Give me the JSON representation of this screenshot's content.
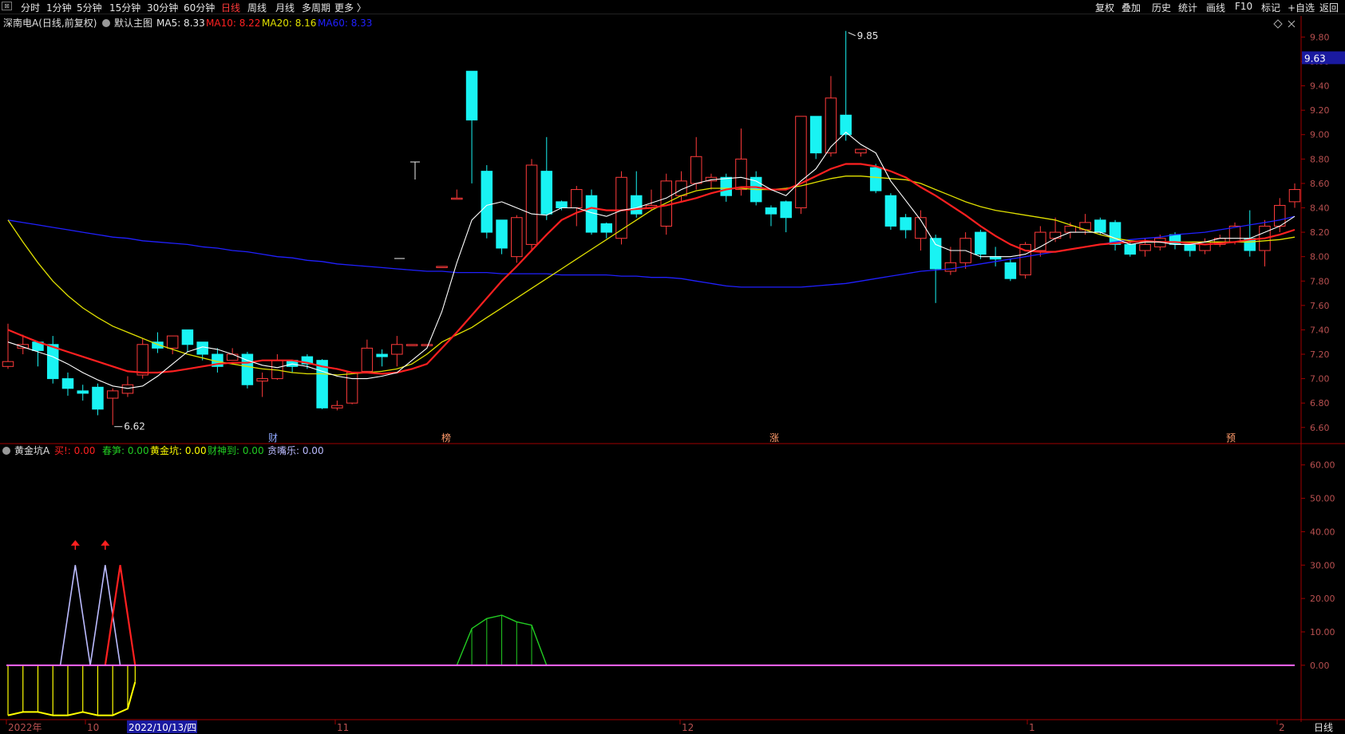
{
  "toolbar": {
    "menu_icon": "window-menu-icon",
    "periods": [
      "分时",
      "1分钟",
      "5分钟",
      "15分钟",
      "30分钟",
      "60分钟",
      "日线",
      "周线",
      "月线",
      "多周期",
      "更多 〉"
    ],
    "active_period": "日线",
    "right_buttons": [
      "复权",
      "叠加",
      "历史",
      "统计",
      "画线",
      "F10",
      "标记",
      "+自选",
      "返回"
    ]
  },
  "colors": {
    "up": "#ff3b3b",
    "down": "#19f3f3",
    "ma5": "#ffffff",
    "ma10": "#ff2020",
    "ma20": "#e0e000",
    "ma60": "#2020ff",
    "axis": "#a00000",
    "gold_line": "#ff66ff",
    "gold_fill": "#ffff00",
    "spring": "#22cc22",
    "lavender": "#bbbbff"
  },
  "main_panel": {
    "title": "深南电A(日线,前复权)",
    "main_label": "默认主图",
    "ma_labels": [
      "MA5: 8.33",
      "MA10: 8.22",
      "MA20: 8.16",
      "MA60: 8.33"
    ],
    "high_label": "9.85",
    "low_label": "6.62",
    "current_price": "9.63",
    "event_marks": [
      "财",
      "榜",
      "涨",
      "预"
    ],
    "corner_icons": [
      "diamond-icon",
      "close-icon"
    ]
  },
  "sub_panel": {
    "title": "黄金坑A",
    "indicators": [
      {
        "label": "买!: 0.00",
        "color": "#ff2020"
      },
      {
        "label": "春笋: 0.00",
        "color": "#22cc22"
      },
      {
        "label": "黄金坑: 0.00",
        "color": "#ffff00"
      },
      {
        "label": "财神到: 0.00",
        "color": "#22cc22"
      },
      {
        "label": "贪嘴乐: 0.00",
        "color": "#bbbbff"
      }
    ]
  },
  "x_axis": {
    "labels": [
      "2022年",
      "10",
      "2022/10/13/四",
      "11",
      "12",
      "1",
      "2"
    ],
    "period_label": "日线"
  },
  "chart_data": [
    {
      "type": "candlestick",
      "title": "深南电A(日线,前复权)",
      "y_ticks": [
        "9.80",
        "9.60",
        "9.40",
        "9.20",
        "9.00",
        "8.80",
        "8.60",
        "8.40",
        "8.20",
        "8.00",
        "7.80",
        "7.60",
        "7.40",
        "7.20",
        "7.00",
        "6.80",
        "6.60"
      ],
      "ylim": [
        6.52,
        9.94
      ],
      "candles": [
        [
          7.1,
          7.14,
          7.45,
          7.08
        ],
        [
          7.25,
          7.28,
          7.36,
          7.2
        ],
        [
          7.3,
          7.23,
          7.3,
          7.1
        ],
        [
          7.28,
          7.0,
          7.35,
          6.96
        ],
        [
          7.0,
          6.92,
          7.05,
          6.86
        ],
        [
          6.9,
          6.88,
          6.95,
          6.82
        ],
        [
          6.93,
          6.75,
          6.96,
          6.7
        ],
        [
          6.84,
          6.9,
          6.92,
          6.62
        ],
        [
          6.88,
          6.95,
          7.02,
          6.85
        ],
        [
          7.03,
          7.28,
          7.33,
          7.0
        ],
        [
          7.3,
          7.25,
          7.38,
          7.21
        ],
        [
          7.25,
          7.35,
          7.35,
          7.2
        ],
        [
          7.4,
          7.28,
          7.4,
          7.22
        ],
        [
          7.3,
          7.2,
          7.3,
          7.15
        ],
        [
          7.2,
          7.1,
          7.25,
          7.05
        ],
        [
          7.15,
          7.2,
          7.25,
          7.15
        ],
        [
          7.2,
          6.95,
          7.22,
          6.92
        ],
        [
          6.98,
          7.0,
          7.05,
          6.85
        ],
        [
          7.0,
          7.15,
          7.2,
          6.99
        ],
        [
          7.15,
          7.1,
          7.15,
          7.05
        ],
        [
          7.18,
          7.12,
          7.2,
          7.08
        ],
        [
          7.15,
          6.76,
          7.16,
          6.75
        ],
        [
          6.76,
          6.78,
          6.82,
          6.74
        ],
        [
          6.8,
          7.05,
          7.05,
          6.79
        ],
        [
          7.06,
          7.25,
          7.32,
          7.05
        ],
        [
          7.2,
          7.18,
          7.24,
          7.1
        ],
        [
          7.2,
          7.28,
          7.35,
          7.1
        ],
        [
          7.28,
          7.28,
          7.28,
          7.28
        ],
        [
          7.28,
          7.28,
          7.28,
          7.28
        ],
        [
          7.92,
          7.92,
          7.92,
          7.92
        ],
        [
          8.48,
          8.48,
          8.55,
          8.48
        ],
        [
          9.52,
          9.12,
          9.52,
          8.6
        ],
        [
          8.7,
          8.2,
          8.75,
          8.15
        ],
        [
          8.3,
          8.07,
          8.3,
          8.02
        ],
        [
          8.0,
          8.32,
          8.34,
          7.95
        ],
        [
          8.1,
          8.75,
          8.8,
          8.05
        ],
        [
          8.7,
          8.35,
          8.98,
          8.3
        ],
        [
          8.45,
          8.4,
          8.46,
          8.38
        ],
        [
          8.4,
          8.55,
          8.58,
          8.25
        ],
        [
          8.5,
          8.2,
          8.55,
          8.18
        ],
        [
          8.27,
          8.2,
          8.28,
          8.15
        ],
        [
          8.15,
          8.65,
          8.7,
          8.1
        ],
        [
          8.5,
          8.35,
          8.7,
          8.32
        ],
        [
          8.4,
          8.42,
          8.55,
          8.38
        ],
        [
          8.25,
          8.62,
          8.68,
          8.18
        ],
        [
          8.5,
          8.62,
          8.7,
          8.45
        ],
        [
          8.6,
          8.82,
          8.98,
          8.55
        ],
        [
          8.62,
          8.65,
          8.68,
          8.55
        ],
        [
          8.65,
          8.5,
          8.68,
          8.45
        ],
        [
          8.55,
          8.8,
          9.05,
          8.5
        ],
        [
          8.65,
          8.45,
          8.7,
          8.42
        ],
        [
          8.4,
          8.35,
          8.42,
          8.25
        ],
        [
          8.45,
          8.32,
          8.46,
          8.2
        ],
        [
          8.4,
          9.15,
          9.15,
          8.35
        ],
        [
          9.15,
          8.85,
          9.15,
          8.8
        ],
        [
          8.85,
          9.3,
          9.48,
          8.82
        ],
        [
          9.16,
          9.0,
          9.85,
          8.95
        ],
        [
          8.85,
          8.88,
          8.88,
          8.82
        ],
        [
          8.73,
          8.54,
          8.76,
          8.52
        ],
        [
          8.5,
          8.25,
          8.52,
          8.22
        ],
        [
          8.32,
          8.22,
          8.35,
          8.15
        ],
        [
          8.15,
          8.32,
          8.38,
          8.05
        ],
        [
          8.15,
          7.9,
          8.18,
          7.62
        ],
        [
          7.88,
          7.95,
          8.08,
          7.85
        ],
        [
          7.95,
          8.15,
          8.2,
          7.9
        ],
        [
          8.2,
          8.02,
          8.22,
          7.98
        ],
        [
          8.0,
          7.98,
          8.08,
          7.92
        ],
        [
          7.95,
          7.82,
          7.98,
          7.8
        ],
        [
          7.85,
          8.1,
          8.12,
          7.82
        ],
        [
          8.05,
          8.2,
          8.25,
          8.0
        ],
        [
          8.15,
          8.2,
          8.32,
          8.12
        ],
        [
          8.2,
          8.25,
          8.28,
          8.15
        ],
        [
          8.22,
          8.28,
          8.35,
          8.18
        ],
        [
          8.3,
          8.2,
          8.32,
          8.18
        ],
        [
          8.28,
          8.1,
          8.3,
          8.05
        ],
        [
          8.1,
          8.02,
          8.12,
          8.0
        ],
        [
          8.05,
          8.1,
          8.15,
          8.0
        ],
        [
          8.08,
          8.15,
          8.18,
          8.05
        ],
        [
          8.18,
          8.1,
          8.2,
          8.06
        ],
        [
          8.1,
          8.05,
          8.12,
          8.0
        ],
        [
          8.05,
          8.12,
          8.15,
          8.02
        ],
        [
          8.1,
          8.15,
          8.18,
          8.08
        ],
        [
          8.12,
          8.25,
          8.28,
          8.1
        ],
        [
          8.15,
          8.05,
          8.38,
          8.0
        ],
        [
          8.05,
          8.25,
          8.3,
          7.92
        ],
        [
          8.25,
          8.42,
          8.48,
          8.2
        ],
        [
          8.45,
          8.55,
          8.6,
          8.4
        ]
      ],
      "ma5": [
        7.3,
        7.26,
        7.22,
        7.18,
        7.12,
        7.05,
        6.99,
        6.94,
        6.92,
        6.94,
        7.02,
        7.12,
        7.22,
        7.26,
        7.24,
        7.2,
        7.15,
        7.11,
        7.09,
        7.12,
        7.1,
        7.06,
        7.02,
        7.0,
        7.0,
        7.02,
        7.05,
        7.15,
        7.25,
        7.55,
        7.95,
        8.3,
        8.42,
        8.45,
        8.4,
        8.35,
        8.34,
        8.4,
        8.4,
        8.36,
        8.33,
        8.38,
        8.4,
        8.44,
        8.48,
        8.55,
        8.6,
        8.63,
        8.64,
        8.65,
        8.62,
        8.55,
        8.5,
        8.62,
        8.72,
        8.9,
        9.02,
        8.92,
        8.85,
        8.62,
        8.46,
        8.3,
        8.1,
        8.05,
        8.05,
        8.0,
        8.0,
        8.0,
        8.02,
        8.08,
        8.15,
        8.2,
        8.2,
        8.2,
        8.15,
        8.1,
        8.12,
        8.12,
        8.1,
        8.1,
        8.12,
        8.15,
        8.15,
        8.15,
        8.2,
        8.25,
        8.33
      ],
      "ma10": [
        7.4,
        7.35,
        7.3,
        7.26,
        7.22,
        7.18,
        7.14,
        7.1,
        7.06,
        7.05,
        7.05,
        7.06,
        7.08,
        7.1,
        7.12,
        7.13,
        7.13,
        7.15,
        7.15,
        7.15,
        7.13,
        7.1,
        7.08,
        7.05,
        7.05,
        7.04,
        7.05,
        7.08,
        7.12,
        7.25,
        7.38,
        7.52,
        7.66,
        7.8,
        7.92,
        8.05,
        8.18,
        8.3,
        8.36,
        8.4,
        8.38,
        8.38,
        8.39,
        8.4,
        8.42,
        8.45,
        8.48,
        8.52,
        8.55,
        8.57,
        8.57,
        8.55,
        8.55,
        8.6,
        8.66,
        8.72,
        8.76,
        8.76,
        8.74,
        8.7,
        8.65,
        8.57,
        8.5,
        8.42,
        8.34,
        8.25,
        8.17,
        8.1,
        8.05,
        8.04,
        8.04,
        8.06,
        8.08,
        8.1,
        8.11,
        8.12,
        8.13,
        8.12,
        8.12,
        8.11,
        8.1,
        8.11,
        8.12,
        8.14,
        8.15,
        8.18,
        8.22
      ],
      "ma20": [
        8.3,
        8.12,
        7.95,
        7.8,
        7.68,
        7.58,
        7.5,
        7.43,
        7.38,
        7.33,
        7.28,
        7.24,
        7.2,
        7.17,
        7.14,
        7.12,
        7.1,
        7.08,
        7.07,
        7.05,
        7.04,
        7.04,
        7.03,
        7.04,
        7.05,
        7.06,
        7.08,
        7.12,
        7.2,
        7.3,
        7.36,
        7.42,
        7.5,
        7.58,
        7.66,
        7.74,
        7.82,
        7.9,
        7.98,
        8.06,
        8.14,
        8.22,
        8.3,
        8.38,
        8.44,
        8.5,
        8.54,
        8.56,
        8.56,
        8.56,
        8.55,
        8.55,
        8.56,
        8.58,
        8.61,
        8.64,
        8.66,
        8.66,
        8.65,
        8.64,
        8.63,
        8.6,
        8.55,
        8.5,
        8.45,
        8.41,
        8.38,
        8.36,
        8.34,
        8.32,
        8.3,
        8.26,
        8.22,
        8.18,
        8.15,
        8.13,
        8.12,
        8.12,
        8.12,
        8.12,
        8.12,
        8.12,
        8.12,
        8.12,
        8.13,
        8.14,
        8.16
      ],
      "ma60": [
        8.3,
        8.28,
        8.26,
        8.24,
        8.22,
        8.2,
        8.18,
        8.16,
        8.15,
        8.13,
        8.12,
        8.11,
        8.1,
        8.08,
        8.07,
        8.05,
        8.04,
        8.02,
        8.0,
        7.99,
        7.97,
        7.96,
        7.94,
        7.93,
        7.92,
        7.91,
        7.9,
        7.89,
        7.88,
        7.88,
        7.87,
        7.87,
        7.87,
        7.86,
        7.86,
        7.86,
        7.86,
        7.85,
        7.85,
        7.85,
        7.85,
        7.84,
        7.84,
        7.83,
        7.83,
        7.82,
        7.8,
        7.78,
        7.76,
        7.75,
        7.75,
        7.75,
        7.75,
        7.75,
        7.76,
        7.77,
        7.78,
        7.8,
        7.82,
        7.84,
        7.86,
        7.88,
        7.89,
        7.9,
        7.92,
        7.94,
        7.96,
        7.98,
        8.0,
        8.02,
        8.04,
        8.06,
        8.08,
        8.1,
        8.12,
        8.14,
        8.15,
        8.16,
        8.18,
        8.19,
        8.2,
        8.22,
        8.24,
        8.26,
        8.28,
        8.3,
        8.33
      ]
    },
    {
      "type": "line",
      "title": "黄金坑A",
      "y_ticks": [
        "60.00",
        "50.00",
        "40.00",
        "30.00",
        "20.00",
        "10.00",
        "0.00"
      ],
      "ylim": [
        -17,
        64
      ],
      "peaks": [
        {
          "x": [
            3.5,
            4.5,
            5.5
          ],
          "y": [
            0,
            30,
            0
          ],
          "color": "lavender"
        },
        {
          "x": [
            5.5,
            6.5,
            7.5
          ],
          "y": [
            0,
            30,
            0
          ],
          "color": "lavender"
        },
        {
          "x": [
            6.5,
            7.5,
            8.5
          ],
          "y": [
            0,
            30,
            0
          ],
          "color": "red"
        }
      ],
      "buy_arrows_x": [
        4.5,
        6.5
      ],
      "gold_pit": {
        "x": [
          0,
          1,
          2,
          3,
          4,
          5,
          6,
          7,
          8,
          8.5
        ],
        "y": [
          -15,
          -14,
          -14,
          -15,
          -15,
          -14,
          -15,
          -15,
          -13,
          -5
        ]
      },
      "spring_shoots": {
        "x": [
          30,
          31,
          32,
          33,
          34,
          35,
          36
        ],
        "y": [
          0,
          11,
          14,
          15,
          13,
          12,
          0
        ]
      }
    }
  ]
}
